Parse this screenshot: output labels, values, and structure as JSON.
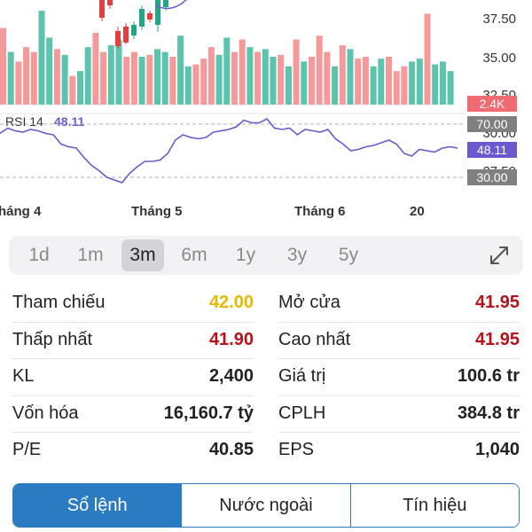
{
  "chart_data": {
    "type": "candlestick+volume+line",
    "price_axis": {
      "ticks": [
        "37.50",
        "35.00",
        "32.50"
      ]
    },
    "rsi": {
      "label": "RSI 14",
      "value": "48.11",
      "levels": [
        "70.00",
        "30.00"
      ],
      "ticks": [
        "30.00",
        "27.50"
      ],
      "series": [
        63,
        67,
        65,
        64,
        66,
        65,
        63,
        62,
        55,
        53,
        52,
        45,
        39,
        35,
        30,
        28,
        26,
        33,
        38,
        42,
        42,
        43,
        48,
        58,
        62,
        60,
        59,
        60,
        64,
        65,
        66,
        68,
        73,
        71,
        71,
        74,
        67,
        66,
        67,
        62,
        66,
        65,
        64,
        66,
        59,
        55,
        50,
        51,
        53,
        54,
        56,
        58,
        55,
        48,
        46,
        51,
        50,
        49,
        52,
        53,
        52
      ]
    },
    "volume": {
      "last_label": "2.4K",
      "bars": [
        {
          "v": 0.8,
          "c": "red"
        },
        {
          "v": 0.55,
          "c": "green"
        },
        {
          "v": 0.45,
          "c": "red"
        },
        {
          "v": 0.6,
          "c": "red"
        },
        {
          "v": 0.55,
          "c": "red"
        },
        {
          "v": 0.98,
          "c": "green"
        },
        {
          "v": 0.7,
          "c": "green"
        },
        {
          "v": 0.58,
          "c": "red"
        },
        {
          "v": 0.52,
          "c": "green"
        },
        {
          "v": 0.3,
          "c": "red"
        },
        {
          "v": 0.35,
          "c": "green"
        },
        {
          "v": 0.6,
          "c": "green"
        },
        {
          "v": 0.75,
          "c": "red"
        },
        {
          "v": 0.55,
          "c": "red"
        },
        {
          "v": 0.62,
          "c": "green"
        },
        {
          "v": 0.68,
          "c": "green"
        },
        {
          "v": 0.5,
          "c": "red"
        },
        {
          "v": 0.55,
          "c": "red"
        },
        {
          "v": 0.5,
          "c": "green"
        },
        {
          "v": 0.52,
          "c": "red"
        },
        {
          "v": 0.58,
          "c": "green"
        },
        {
          "v": 0.55,
          "c": "green"
        },
        {
          "v": 0.5,
          "c": "red"
        },
        {
          "v": 0.72,
          "c": "green"
        },
        {
          "v": 0.4,
          "c": "green"
        },
        {
          "v": 0.42,
          "c": "red"
        },
        {
          "v": 0.48,
          "c": "red"
        },
        {
          "v": 0.6,
          "c": "red"
        },
        {
          "v": 0.52,
          "c": "green"
        },
        {
          "v": 0.7,
          "c": "green"
        },
        {
          "v": 0.55,
          "c": "red"
        },
        {
          "v": 0.68,
          "c": "red"
        },
        {
          "v": 0.6,
          "c": "green"
        },
        {
          "v": 0.55,
          "c": "red"
        },
        {
          "v": 0.58,
          "c": "green"
        },
        {
          "v": 0.5,
          "c": "green"
        },
        {
          "v": 0.52,
          "c": "red"
        },
        {
          "v": 0.4,
          "c": "green"
        },
        {
          "v": 0.68,
          "c": "red"
        },
        {
          "v": 0.45,
          "c": "green"
        },
        {
          "v": 0.5,
          "c": "red"
        },
        {
          "v": 0.72,
          "c": "red"
        },
        {
          "v": 0.55,
          "c": "red"
        },
        {
          "v": 0.4,
          "c": "green"
        },
        {
          "v": 0.62,
          "c": "red"
        },
        {
          "v": 0.58,
          "c": "green"
        },
        {
          "v": 0.48,
          "c": "red"
        },
        {
          "v": 0.5,
          "c": "red"
        },
        {
          "v": 0.4,
          "c": "green"
        },
        {
          "v": 0.48,
          "c": "green"
        },
        {
          "v": 0.5,
          "c": "red"
        },
        {
          "v": 0.35,
          "c": "red"
        },
        {
          "v": 0.4,
          "c": "red"
        },
        {
          "v": 0.45,
          "c": "green"
        },
        {
          "v": 0.48,
          "c": "green"
        },
        {
          "v": 0.95,
          "c": "red"
        },
        {
          "v": 0.42,
          "c": "green"
        },
        {
          "v": 0.45,
          "c": "green"
        },
        {
          "v": 0.35,
          "c": "green"
        }
      ]
    },
    "x_labels": [
      "háng 4",
      "Tháng 5",
      "Tháng 6",
      "20"
    ],
    "colors": {
      "up": "#5cc3ad",
      "down": "#f5999b",
      "rsi_line": "#6a5acd",
      "rsi_badge": "#6a5acd",
      "level_badge": "#808080",
      "volume_badge": "#f06a6f"
    }
  },
  "periods": [
    {
      "label": "1d",
      "active": false
    },
    {
      "label": "1m",
      "active": false
    },
    {
      "label": "3m",
      "active": true
    },
    {
      "label": "6m",
      "active": false
    },
    {
      "label": "1y",
      "active": false
    },
    {
      "label": "3y",
      "active": false
    },
    {
      "label": "5y",
      "active": false
    }
  ],
  "expand_icon": "expand-arrows-icon",
  "stats": {
    "left": [
      {
        "label": "Tham chiếu",
        "value": "42.00",
        "color": "#e6b800"
      },
      {
        "label": "Thấp nhất",
        "value": "41.90",
        "color": "#b5121b"
      },
      {
        "label": "KL",
        "value": "2,400",
        "color": "#222222"
      },
      {
        "label": "Vốn hóa",
        "value": "16,160.7 tỷ",
        "color": "#222222"
      },
      {
        "label": "P/E",
        "value": "40.85",
        "color": "#222222"
      }
    ],
    "right": [
      {
        "label": "Mở cửa",
        "value": "41.95",
        "color": "#b5121b"
      },
      {
        "label": "Cao nhất",
        "value": "41.95",
        "color": "#b5121b"
      },
      {
        "label": "Giá trị",
        "value": "100.6 tr",
        "color": "#222222"
      },
      {
        "label": "CPLH",
        "value": "384.8 tr",
        "color": "#222222"
      },
      {
        "label": "EPS",
        "value": "1,040",
        "color": "#222222"
      }
    ]
  },
  "tabs": [
    {
      "label": "Sổ lệnh",
      "active": true
    },
    {
      "label": "Nước ngoài",
      "active": false
    },
    {
      "label": "Tín hiệu",
      "active": false
    }
  ]
}
